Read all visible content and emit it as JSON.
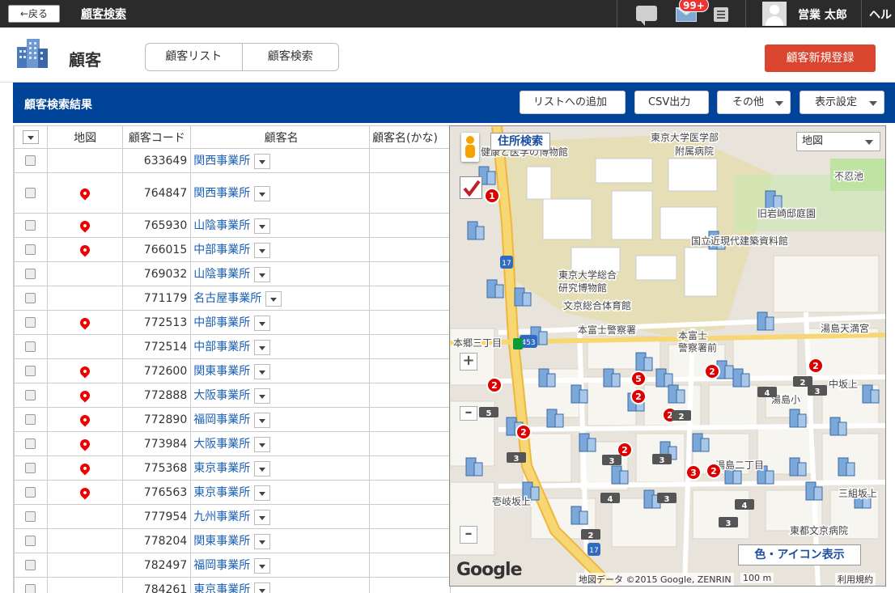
{
  "topbar": {
    "back_label": "←戻る",
    "title": "顧客検索",
    "badge_count": "99+",
    "user_name": "営業 太郎",
    "help_label": "ヘル"
  },
  "header": {
    "title": "顧客",
    "tabs": [
      {
        "label": "顧客リスト"
      },
      {
        "label": "顧客検索"
      }
    ],
    "new_button_label": "顧客新規登録"
  },
  "results": {
    "title": "顧客検索結果",
    "buttons": {
      "add_to_list": "リストへの追加",
      "csv": "CSV出力",
      "other": "その他",
      "display": "表示設定"
    }
  },
  "table": {
    "columns": [
      "地図",
      "顧客コード",
      "顧客名",
      "顧客名(かな)"
    ],
    "rows": [
      {
        "code": "633649",
        "name": "関西事業所",
        "pin": false
      },
      {
        "code": "764847",
        "name": "関西事業所",
        "pin": true
      },
      {
        "code": "765930",
        "name": "山陰事業所",
        "pin": true
      },
      {
        "code": "766015",
        "name": "中部事業所",
        "pin": true
      },
      {
        "code": "769032",
        "name": "山陰事業所",
        "pin": false
      },
      {
        "code": "771179",
        "name": "名古屋事業所",
        "pin": false
      },
      {
        "code": "772513",
        "name": "中部事業所",
        "pin": true
      },
      {
        "code": "772514",
        "name": "中部事業所",
        "pin": false
      },
      {
        "code": "772600",
        "name": "関東事業所",
        "pin": true
      },
      {
        "code": "772888",
        "name": "大阪事業所",
        "pin": true
      },
      {
        "code": "772890",
        "name": "福岡事業所",
        "pin": true
      },
      {
        "code": "773984",
        "name": "大阪事業所",
        "pin": true
      },
      {
        "code": "775368",
        "name": "東京事業所",
        "pin": true
      },
      {
        "code": "776563",
        "name": "東京事業所",
        "pin": true
      },
      {
        "code": "777954",
        "name": "九州事業所",
        "pin": false
      },
      {
        "code": "778204",
        "name": "関東事業所",
        "pin": false
      },
      {
        "code": "782497",
        "name": "福岡事業所",
        "pin": false
      },
      {
        "code": "784261",
        "name": "東京事業所",
        "pin": false
      }
    ]
  },
  "map": {
    "address_search": "住所検索",
    "map_type": "地図",
    "color_icon_button": "色・アイコン表示",
    "google": "Google",
    "credit": "地図データ ©2015 Google, ZENRIN",
    "scale": "100 m",
    "terms": "利用規約",
    "labels": [
      "東京大学医学部",
      "附属病院",
      "健康と医学の博物館",
      "旧岩崎邸庭園",
      "国立近現代建築資料館",
      "東京大学総合",
      "研究博物館",
      "文京総合体育館",
      "本富士警察署",
      "本郷三丁目",
      "湯島天満宮",
      "湯島小",
      "中坂上",
      "湯島二丁目",
      "壱岐坂上",
      "三組坂上",
      "東都文京病院",
      "不忍池",
      "本富士",
      "警察署前"
    ],
    "markers": [
      "1",
      "2",
      "2",
      "2",
      "2",
      "2",
      "2",
      "2",
      "3",
      "2",
      "5"
    ],
    "counts": [
      "2",
      "3",
      "4",
      "5",
      "3",
      "2",
      "3",
      "4",
      "3",
      "3",
      "2",
      "4",
      "3"
    ],
    "route_number": "17",
    "route_number2": "453",
    "colors": {
      "road_main": "#f5d064",
      "block": "#f7f5f0",
      "park": "#c9e8b0",
      "campus": "#e6deb7",
      "marker": "#d00",
      "primary": "#00449a",
      "danger": "#d9452f"
    }
  }
}
